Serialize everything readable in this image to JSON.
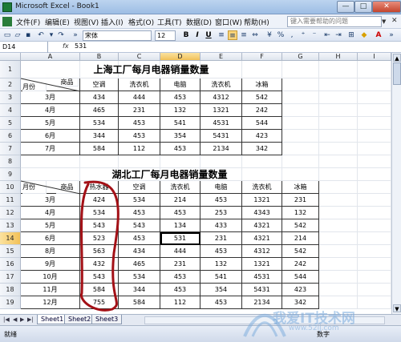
{
  "window": {
    "title": "Microsoft Excel - Book1",
    "min": "—",
    "max": "□",
    "close": "✕"
  },
  "menu": {
    "items": [
      "文件(F)",
      "编辑(E)",
      "视图(V)",
      "插入(I)",
      "格式(O)",
      "工具(T)",
      "数据(D)",
      "窗口(W)",
      "帮助(H)"
    ],
    "help_placeholder": "键入需要帮助的问题"
  },
  "toolbar": {
    "font": "宋体",
    "size": "12",
    "bold": "B",
    "italic": "I",
    "underline": "U"
  },
  "formula": {
    "namebox": "D14",
    "fx": "fx",
    "value": "531"
  },
  "columns": [
    "A",
    "B",
    "C",
    "D",
    "E",
    "F",
    "G",
    "H",
    "I"
  ],
  "rows": [
    "1",
    "2",
    "3",
    "4",
    "5",
    "6",
    "7",
    "8",
    "9",
    "10",
    "11",
    "12",
    "13",
    "14",
    "15",
    "16",
    "17",
    "18",
    "19"
  ],
  "table1": {
    "title": "上海工厂每月电器销量数量",
    "corner_month": "月份",
    "corner_goods": "商品",
    "headers": [
      "空调",
      "洗衣机",
      "电脑",
      "洗衣机",
      "冰箱"
    ],
    "rows": [
      [
        "3月",
        "434",
        "444",
        "453",
        "4312",
        "542"
      ],
      [
        "4月",
        "465",
        "231",
        "132",
        "1321",
        "242"
      ],
      [
        "5月",
        "534",
        "453",
        "541",
        "4531",
        "544"
      ],
      [
        "6月",
        "344",
        "453",
        "354",
        "5431",
        "423"
      ],
      [
        "7月",
        "584",
        "112",
        "453",
        "2134",
        "342"
      ]
    ]
  },
  "table2": {
    "title": "湖北工厂每月电器销量数量",
    "corner_month": "月份",
    "corner_goods": "商品",
    "headers": [
      "热水器",
      "空调",
      "洗衣机",
      "电脑",
      "洗衣机",
      "冰箱"
    ],
    "rows": [
      [
        "3月",
        "424",
        "534",
        "214",
        "453",
        "1321",
        "231"
      ],
      [
        "4月",
        "534",
        "453",
        "453",
        "253",
        "4343",
        "132"
      ],
      [
        "5月",
        "543",
        "543",
        "134",
        "433",
        "4321",
        "542"
      ],
      [
        "6月",
        "523",
        "453",
        "531",
        "231",
        "4321",
        "214"
      ],
      [
        "8月",
        "563",
        "434",
        "444",
        "453",
        "4312",
        "542"
      ],
      [
        "9月",
        "432",
        "465",
        "231",
        "132",
        "1321",
        "242"
      ],
      [
        "10月",
        "543",
        "534",
        "453",
        "541",
        "4531",
        "544"
      ],
      [
        "11月",
        "584",
        "344",
        "453",
        "354",
        "5431",
        "423"
      ],
      [
        "12月",
        "755",
        "584",
        "112",
        "453",
        "2134",
        "342"
      ]
    ]
  },
  "sheets": [
    "Sheet1",
    "Sheet2",
    "Sheet3"
  ],
  "status": {
    "left": "就绪",
    "right": "数字"
  },
  "watermark": {
    "text": "我爱IT技术网",
    "sub": "www.52ij.com"
  }
}
